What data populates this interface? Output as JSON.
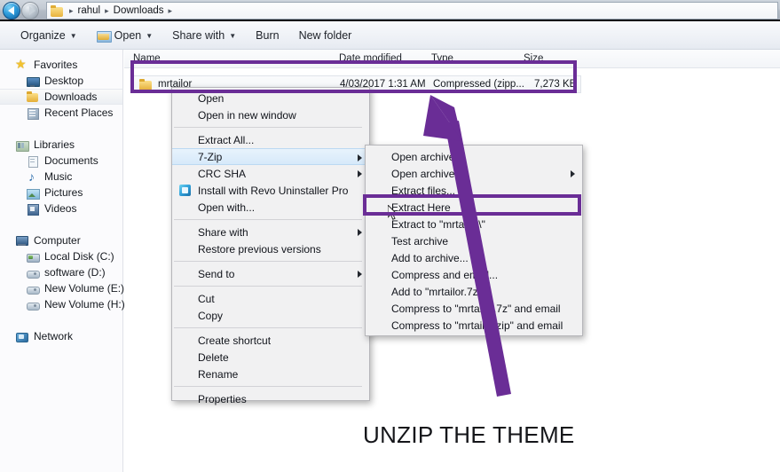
{
  "window": {
    "address_bar": {
      "folder_icon": "folder-icon",
      "crumbs": [
        "rahul",
        "Downloads"
      ],
      "separator": "▸"
    },
    "nav_back_icon": "back-arrow-icon",
    "nav_forward_icon": "forward-arrow-icon"
  },
  "toolbar": {
    "items": [
      {
        "label": "Organize",
        "caret": "▼",
        "icon": null
      },
      {
        "label": "Open",
        "caret": "▼",
        "icon": "open-folder-icon"
      },
      {
        "label": "Share with",
        "caret": "▼",
        "icon": null
      },
      {
        "label": "Burn",
        "caret": "",
        "icon": null
      },
      {
        "label": "New folder",
        "caret": "",
        "icon": null
      }
    ]
  },
  "sidebar": {
    "groups": [
      {
        "header": {
          "label": "Favorites",
          "icon": "star-icon"
        },
        "items": [
          {
            "label": "Desktop",
            "icon": "desktop-icon",
            "selected": false
          },
          {
            "label": "Downloads",
            "icon": "folder-icon",
            "selected": true
          },
          {
            "label": "Recent Places",
            "icon": "recent-places-icon",
            "selected": false
          }
        ]
      },
      {
        "header": {
          "label": "Libraries",
          "icon": "libraries-icon"
        },
        "items": [
          {
            "label": "Documents",
            "icon": "document-icon",
            "selected": false
          },
          {
            "label": "Music",
            "icon": "music-note-icon",
            "selected": false
          },
          {
            "label": "Pictures",
            "icon": "picture-icon",
            "selected": false
          },
          {
            "label": "Videos",
            "icon": "video-icon",
            "selected": false
          }
        ]
      },
      {
        "header": {
          "label": "Computer",
          "icon": "computer-icon"
        },
        "items": [
          {
            "label": "Local Disk (C:)",
            "icon": "hard-disk-icon",
            "selected": false
          },
          {
            "label": "software (D:)",
            "icon": "drive-icon",
            "selected": false
          },
          {
            "label": "New Volume (E:)",
            "icon": "drive-icon",
            "selected": false
          },
          {
            "label": "New Volume (H:)",
            "icon": "drive-icon",
            "selected": false
          }
        ]
      },
      {
        "header": {
          "label": "Network",
          "icon": "network-icon"
        },
        "items": []
      }
    ]
  },
  "file_list": {
    "columns": [
      "Name",
      "Date modified",
      "Type",
      "Size"
    ],
    "rows": [
      {
        "name": "mrtailor",
        "date_modified": "4/03/2017 1:31 AM",
        "type": "Compressed (zipp...",
        "size": "7,273 KB",
        "icon": "archive-folder-icon"
      }
    ]
  },
  "context_menu": {
    "items": [
      {
        "label": "Open",
        "type": "item"
      },
      {
        "label": "Open in new window",
        "type": "item"
      },
      {
        "type": "separator"
      },
      {
        "label": "Extract All...",
        "type": "item"
      },
      {
        "label": "7-Zip",
        "type": "item",
        "submenu": true,
        "hover": true
      },
      {
        "label": "CRC SHA",
        "type": "item",
        "submenu": true
      },
      {
        "label": "Install with Revo Uninstaller Pro",
        "type": "item",
        "icon": "revo-uninstaller-icon"
      },
      {
        "label": "Open with...",
        "type": "item"
      },
      {
        "type": "separator"
      },
      {
        "label": "Share with",
        "type": "item",
        "submenu": true
      },
      {
        "label": "Restore previous versions",
        "type": "item"
      },
      {
        "type": "separator"
      },
      {
        "label": "Send to",
        "type": "item",
        "submenu": true
      },
      {
        "type": "separator"
      },
      {
        "label": "Cut",
        "type": "item"
      },
      {
        "label": "Copy",
        "type": "item"
      },
      {
        "type": "separator"
      },
      {
        "label": "Create shortcut",
        "type": "item"
      },
      {
        "label": "Delete",
        "type": "item"
      },
      {
        "label": "Rename",
        "type": "item"
      },
      {
        "type": "separator"
      },
      {
        "label": "Properties",
        "type": "item"
      }
    ]
  },
  "sevenzip_submenu": {
    "items": [
      {
        "label": "Open archive",
        "type": "item"
      },
      {
        "label": "Open archive",
        "type": "item",
        "submenu": true
      },
      {
        "label": "Extract files...",
        "type": "item"
      },
      {
        "label": "Extract Here",
        "type": "item",
        "highlighted": true
      },
      {
        "label": "Extract to \"mrtailor\\\"",
        "type": "item"
      },
      {
        "label": "Test archive",
        "type": "item"
      },
      {
        "label": "Add to archive...",
        "type": "item"
      },
      {
        "label": "Compress and email...",
        "type": "item"
      },
      {
        "label": "Add to \"mrtailor.7z\"",
        "type": "item"
      },
      {
        "label": "Compress to \"mrtailor.7z\" and email",
        "type": "item"
      },
      {
        "label": "Compress to \"mrtailor.zip\" and email",
        "type": "item"
      }
    ]
  },
  "annotations": {
    "accent_color": "#6a2d96",
    "caption": "UNZIP THE THEME",
    "arrow": "purple-arrow-pointing-to-file-row",
    "highlight_file_row": "mrtailor",
    "highlight_menu_item": "Extract Here"
  }
}
